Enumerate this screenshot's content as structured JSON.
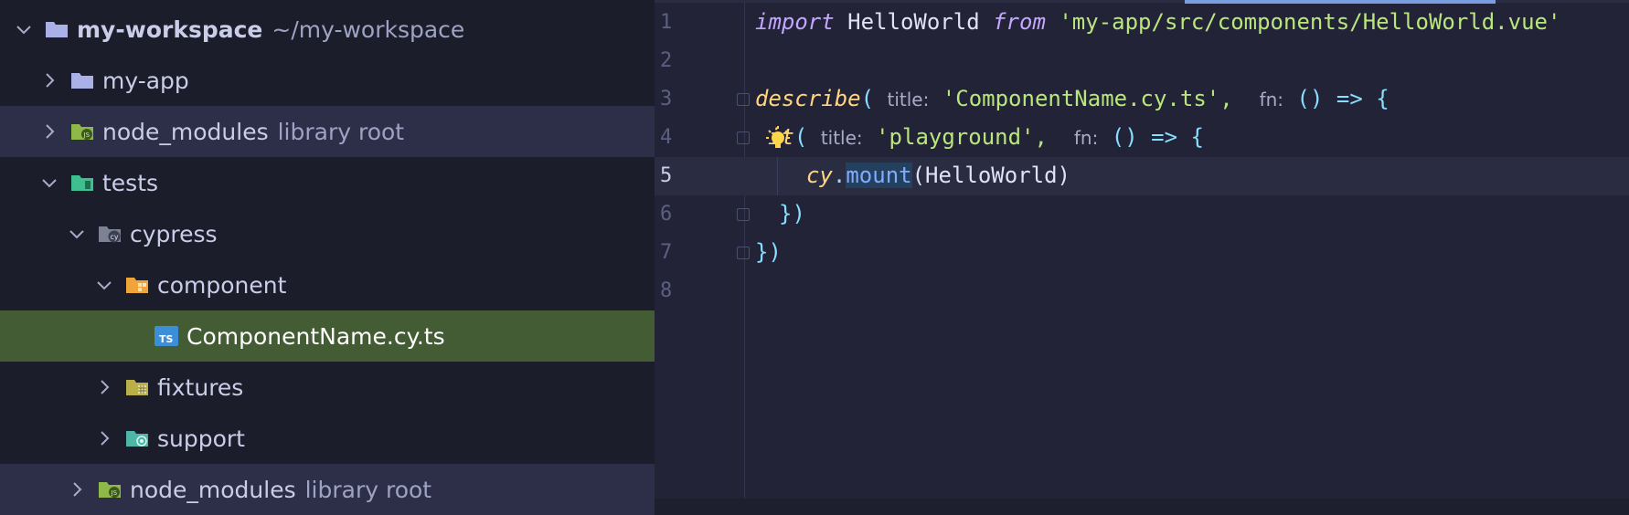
{
  "sidebar": {
    "rows": [
      {
        "label": "my-workspace",
        "hint": "~/my-workspace"
      },
      {
        "label": "my-app"
      },
      {
        "label": "node_modules",
        "hint": "library root"
      },
      {
        "label": "tests"
      },
      {
        "label": "cypress"
      },
      {
        "label": "component"
      },
      {
        "label": "ComponentName.cy.ts"
      },
      {
        "label": "fixtures"
      },
      {
        "label": "support"
      },
      {
        "label": "node_modules",
        "hint": "library root"
      }
    ]
  },
  "editor": {
    "line_numbers": [
      "1",
      "2",
      "3",
      "4",
      "5",
      "6",
      "7",
      "8"
    ],
    "line1": {
      "import": "import",
      "name": "HelloWorld",
      "from": "from",
      "path": "'my-app/src/components/HelloWorld.vue'"
    },
    "line3": {
      "describe": "describe",
      "title_hint": "title:",
      "title": "'ComponentName.cy.ts',",
      "fn_hint": "fn:",
      "arrow": "() => {"
    },
    "line4": {
      "it": "it",
      "title_hint": "title:",
      "title": "'playground',",
      "fn_hint": "fn:",
      "arrow": "() => {"
    },
    "line5": {
      "cy": "cy",
      "mount": "mount",
      "args": "(HelloWorld)"
    },
    "line6": "})",
    "line7": "})"
  },
  "icons": {
    "folder": "folder-icon",
    "node_modules": "nodejs-folder-icon",
    "tests": "test-folder-icon",
    "cypress": "cypress-folder-icon",
    "component": "component-folder-icon",
    "typescript": "typescript-file-icon",
    "fixtures": "fixtures-folder-icon",
    "support": "support-folder-icon",
    "bulb": "lightbulb-icon"
  },
  "colors": {
    "selection": "#445c33",
    "library_row": "#2d2f48",
    "accent": "#7a9ee0"
  }
}
